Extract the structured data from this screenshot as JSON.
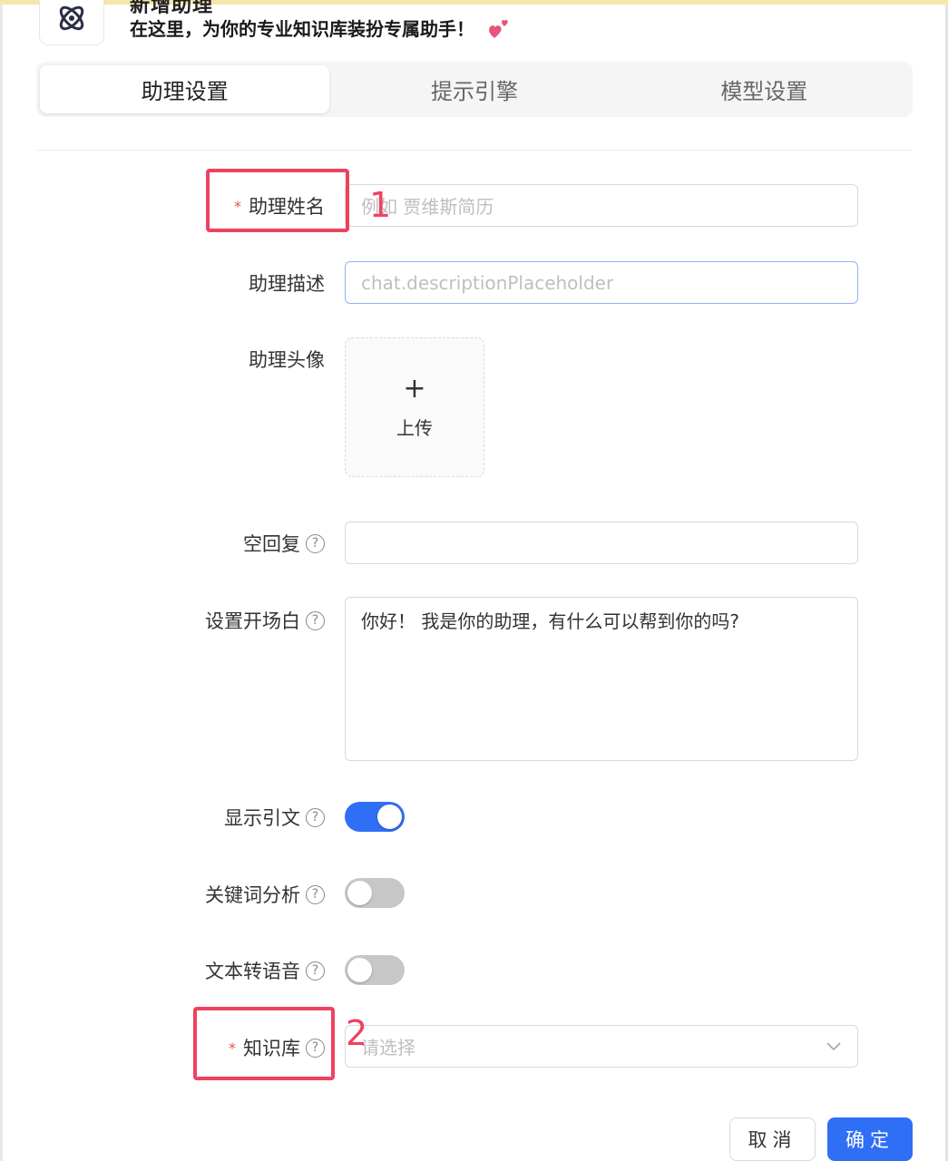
{
  "header": {
    "title": "新增助理",
    "subtitle": "在这里，为你的专业知识库装扮专属助手！"
  },
  "tabs": [
    {
      "label": "助理设置"
    },
    {
      "label": "提示引擎"
    },
    {
      "label": "模型设置"
    }
  ],
  "form": {
    "name": {
      "label": "助理姓名",
      "required": "*",
      "placeholder": "例如 贾维斯简历"
    },
    "description": {
      "label": "助理描述",
      "placeholder": "chat.descriptionPlaceholder"
    },
    "avatar": {
      "label": "助理头像",
      "plus": "+",
      "upload_label": "上传"
    },
    "empty_response": {
      "label": "空回复",
      "help": "?",
      "value": ""
    },
    "opener": {
      "label": "设置开场白",
      "help": "?",
      "value": "你好！ 我是你的助理，有什么可以帮到你的吗?"
    },
    "show_quote": {
      "label": "显示引文",
      "help": "?",
      "enabled": true
    },
    "keyword_analysis": {
      "label": "关键词分析",
      "help": "?",
      "enabled": false
    },
    "tts": {
      "label": "文本转语音",
      "help": "?",
      "enabled": false
    },
    "knowledge_base": {
      "label": "知识库",
      "required": "*",
      "help": "?",
      "placeholder": "请选择"
    }
  },
  "annotations": {
    "one": "1",
    "two": "2"
  },
  "buttons": {
    "cancel": "取消",
    "ok": "确定"
  },
  "colors": {
    "primary": "#2f6ff5",
    "annotation": "#ef4160",
    "required": "#e8554e"
  }
}
